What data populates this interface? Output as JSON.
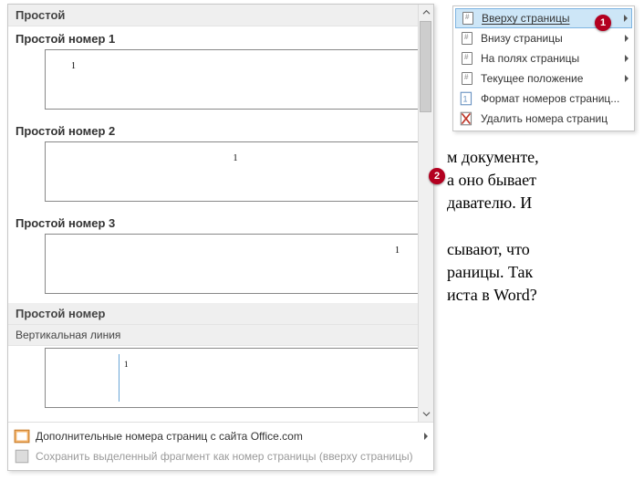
{
  "context_menu": {
    "items": [
      {
        "label": "Вверху страницы",
        "icon": "page-top-icon",
        "has_sub": true,
        "highlighted": true
      },
      {
        "label": "Внизу страницы",
        "icon": "page-bottom-icon",
        "has_sub": true
      },
      {
        "label": "На полях страницы",
        "icon": "page-margin-icon",
        "has_sub": true
      },
      {
        "label": "Текущее положение",
        "icon": "page-current-icon",
        "has_sub": true
      },
      {
        "label": "Формат номеров страниц...",
        "icon": "format-icon",
        "has_sub": false
      },
      {
        "label": "Удалить номера страниц",
        "icon": "delete-icon",
        "has_sub": false
      }
    ]
  },
  "gallery": {
    "group_header": "Простой",
    "items": [
      {
        "label": "Простой номер 1",
        "align": "left"
      },
      {
        "label": "Простой номер 2",
        "align": "center"
      },
      {
        "label": "Простой номер 3",
        "align": "right"
      }
    ],
    "group_header2": "Простой номер",
    "item2_label": "Вертикальная линия",
    "sample_number": "1",
    "footer": {
      "more": "Дополнительные номера страниц с сайта Office.com",
      "save": "Сохранить выделенный фрагмент как номер страницы (вверху страницы)"
    }
  },
  "doc_text": "м документе,\nа оно бывает\nдавателю. И\n\nсывают, что\nраницы. Так\nиста в Word?",
  "callouts": {
    "c1": "1",
    "c2": "2"
  }
}
